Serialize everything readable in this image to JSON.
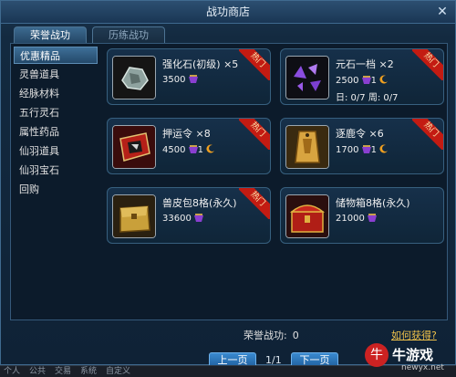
{
  "window": {
    "title": "战功商店"
  },
  "tabs": [
    {
      "label": "荣誉战功",
      "active": true
    },
    {
      "label": "历练战功",
      "active": false
    }
  ],
  "sidebar": {
    "items": [
      {
        "label": "优惠精品",
        "active": true
      },
      {
        "label": "灵兽道具"
      },
      {
        "label": "经脉材料"
      },
      {
        "label": "五行灵石"
      },
      {
        "label": "属性药品"
      },
      {
        "label": "仙羽道具"
      },
      {
        "label": "仙羽宝石"
      },
      {
        "label": "回购"
      }
    ]
  },
  "items": [
    {
      "name": "强化石(初级)",
      "qty": "×5",
      "price": "3500",
      "moon_count": "",
      "limit": "",
      "hot": "热门",
      "icon": "strengthen-stone-icon"
    },
    {
      "name": "元石一档",
      "qty": "×2",
      "price": "2500",
      "moon_count": "1",
      "limit": "日: 0/7 周: 0/7",
      "hot": "热门",
      "icon": "yuan-stone-icon"
    },
    {
      "name": "押运令",
      "qty": "×8",
      "price": "4500",
      "moon_count": "1",
      "limit": "",
      "hot": "热门",
      "icon": "escort-token-icon"
    },
    {
      "name": "逐鹿令",
      "qty": "×6",
      "price": "1700",
      "moon_count": "1",
      "limit": "",
      "hot": "热门",
      "icon": "deer-token-icon"
    },
    {
      "name": "兽皮包8格(永久)",
      "qty": "",
      "price": "33600",
      "moon_count": "",
      "limit": "",
      "hot": "热门",
      "icon": "hide-bag-icon"
    },
    {
      "name": "储物箱8格(永久)",
      "qty": "",
      "price": "21000",
      "moon_count": "",
      "limit": "",
      "hot": "",
      "icon": "storage-chest-icon"
    }
  ],
  "footer": {
    "honor_label": "荣誉战功:",
    "honor_value": "0",
    "how_link": "如何获得?",
    "prev_button": "上一页",
    "next_button": "下一页",
    "page_indicator": "1/1"
  },
  "chat_tabs": [
    "个人",
    "公共",
    "交易",
    "系统",
    "自定义"
  ],
  "watermark": {
    "brand": "牛游戏",
    "url": "newyx.net",
    "logo_char": "牛"
  },
  "colors": {
    "hot_ribbon": "#c31b12",
    "link": "#f0c24a",
    "button": "#2a74b8",
    "coin": "#8a3fd0",
    "moon": "#f0a020"
  }
}
